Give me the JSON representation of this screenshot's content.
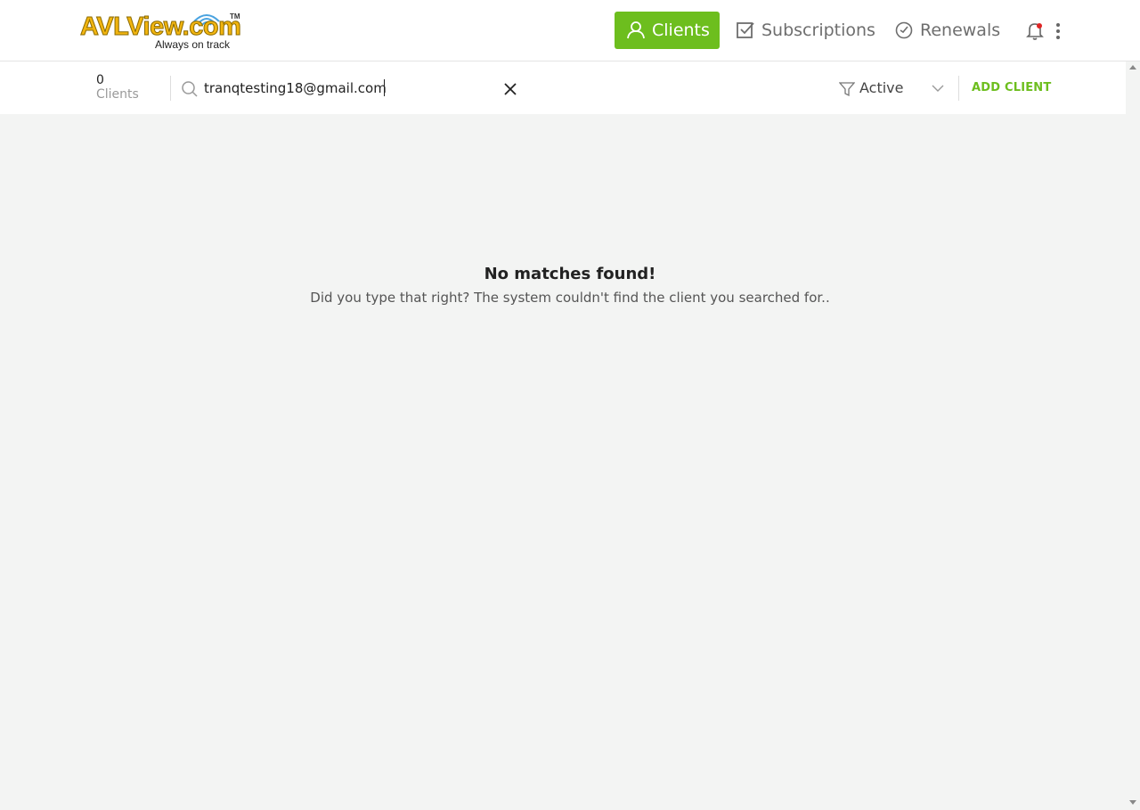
{
  "header": {
    "logo_text": "AVLView.com",
    "logo_tm": "TM",
    "logo_tagline": "Always on track",
    "nav": {
      "clients": "Clients",
      "subscriptions": "Subscriptions",
      "renewals": "Renewals"
    },
    "accent_color": "#6dbe1e"
  },
  "toolbar": {
    "client_count": "0",
    "client_count_label": "Clients",
    "search_value": "tranqtesting18@gmail.com",
    "filter_value": "Active",
    "add_client_label": "ADD CLIENT"
  },
  "empty_state": {
    "title": "No matches found!",
    "message": "Did you type that right? The system couldn't find the client you searched for.."
  }
}
